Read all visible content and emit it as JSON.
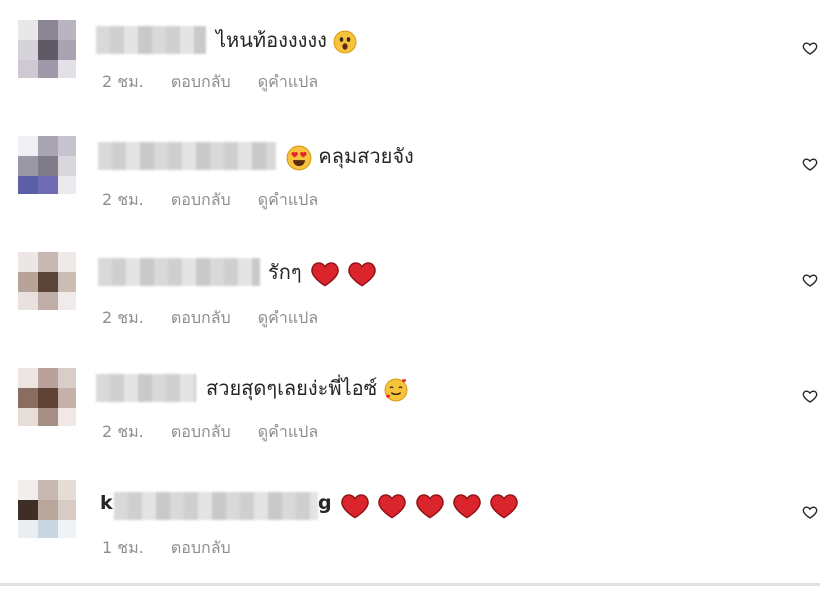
{
  "comments": [
    {
      "text": "ไหนท้องงงงง",
      "emoji": "astonished-face",
      "time": "2 ชม.",
      "reply": "ตอบกลับ",
      "translate": "ดูคำแปล",
      "avatar_colors": [
        "#e9e7ea",
        "#8c8596",
        "#b9b4c0",
        "#d6d2da",
        "#5f5a66",
        "#a9a2b0",
        "#cfc9d3",
        "#9e98a8",
        "#e4e1e6"
      ]
    },
    {
      "text": "คลุมสวยจัง",
      "emoji": "heart-eyes-face",
      "time": "2 ชม.",
      "reply": "ตอบกลับ",
      "translate": "ดูคำแปล",
      "avatar_colors": [
        "#f0eff3",
        "#a8a4b2",
        "#c6c3cc",
        "#9b98a5",
        "#7f7b88",
        "#d9d7dd",
        "#5d5fa6",
        "#6f6cb3",
        "#ebeaee"
      ]
    },
    {
      "text": "รักๆ",
      "emoji": "red-heart x2",
      "time": "2 ชม.",
      "reply": "ตอบกลับ",
      "translate": "ดูคำแปล",
      "avatar_colors": [
        "#ece6e4",
        "#c9b8b2",
        "#efe9e7",
        "#b8a39a",
        "#5a4438",
        "#cdbcb4",
        "#e9e1de",
        "#bfaea7",
        "#f0ebea"
      ]
    },
    {
      "text": "สวยสุดๆเลยง่ะพี่ไอซ์",
      "emoji": "smiling-face-with-hearts",
      "time": "2 ชม.",
      "reply": "ตอบกลับ",
      "translate": "ดูคำแปล",
      "avatar_colors": [
        "#ede5e2",
        "#b8a299",
        "#d9cdc8",
        "#8a6c60",
        "#5f4337",
        "#c4b1a9",
        "#e6dcd8",
        "#a58e84",
        "#efe8e6"
      ]
    },
    {
      "username_start": "k",
      "username_end": "g",
      "emoji": "red-heart x5",
      "time": "1 ชม.",
      "reply": "ตอบกลับ",
      "translate": "",
      "avatar_colors": [
        "#f2eeec",
        "#c7b9b1",
        "#e6dcd6",
        "#3f2e26",
        "#b9a79c",
        "#d8cbc4",
        "#e9eef2",
        "#c9d6df",
        "#f0f3f5"
      ]
    }
  ]
}
